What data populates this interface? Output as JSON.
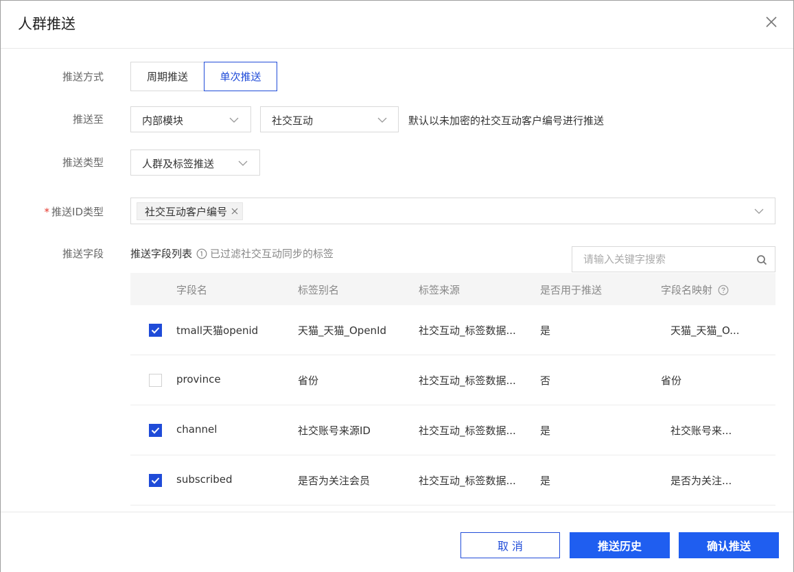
{
  "dialog": {
    "title": "人群推送"
  },
  "form": {
    "push_mode": {
      "label": "推送方式",
      "options": [
        "周期推送",
        "单次推送"
      ],
      "selected": "单次推送"
    },
    "push_to": {
      "label": "推送至",
      "module": "内部模块",
      "target": "社交互动",
      "hint": "默认以未加密的社交互动客户编号进行推送"
    },
    "push_type": {
      "label": "推送类型",
      "value": "人群及标签推送"
    },
    "push_id_type": {
      "label": "推送ID类型",
      "required_mark": "*",
      "tag": "社交互动客户编号"
    },
    "push_fields": {
      "label": "推送字段",
      "list_title": "推送字段列表",
      "list_note": "已过滤社交互动同步的标签",
      "search_placeholder": "请输入关键字搜索"
    }
  },
  "table": {
    "headers": [
      "字段名",
      "标签别名",
      "标签来源",
      "是否用于推送",
      "字段名映射"
    ],
    "rows": [
      {
        "checked": true,
        "field": "tmall天猫openid",
        "alias": "天猫_天猫_OpenId",
        "source": "社交互动_标签数据...",
        "push": "是",
        "mapping": "天猫_天猫_O..."
      },
      {
        "checked": false,
        "field": "province",
        "alias": "省份",
        "source": "社交互动_标签数据...",
        "push": "否",
        "mapping": "省份"
      },
      {
        "checked": true,
        "field": "channel",
        "alias": "社交账号来源ID",
        "source": "社交互动_标签数据...",
        "push": "是",
        "mapping": "社交账号来..."
      },
      {
        "checked": true,
        "field": "subscribed",
        "alias": "是否为关注会员",
        "source": "社交互动_标签数据...",
        "push": "是",
        "mapping": "是否为关注..."
      }
    ]
  },
  "footer": {
    "cancel": "取 消",
    "history": "推送历史",
    "confirm": "确认推送"
  },
  "colors": {
    "accent": "#1f4bd8",
    "primary_button": "#1f5ef0",
    "required": "#e5372c"
  }
}
